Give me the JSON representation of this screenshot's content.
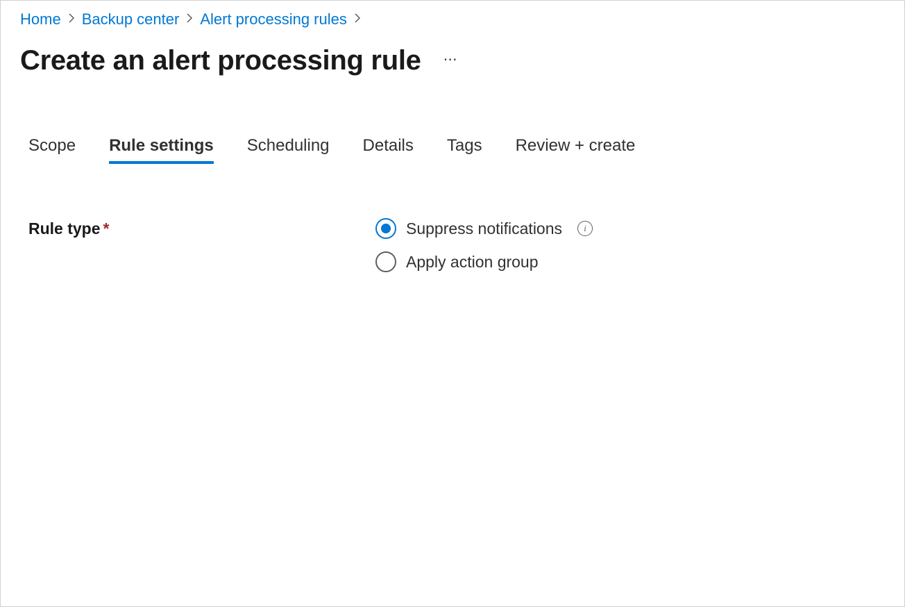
{
  "breadcrumb": {
    "items": [
      {
        "label": "Home"
      },
      {
        "label": "Backup center"
      },
      {
        "label": "Alert processing rules"
      }
    ]
  },
  "page": {
    "title": "Create an alert processing rule"
  },
  "tabs": [
    {
      "label": "Scope",
      "active": false
    },
    {
      "label": "Rule settings",
      "active": true
    },
    {
      "label": "Scheduling",
      "active": false
    },
    {
      "label": "Details",
      "active": false
    },
    {
      "label": "Tags",
      "active": false
    },
    {
      "label": "Review + create",
      "active": false
    }
  ],
  "form": {
    "ruleType": {
      "label": "Rule type",
      "required": "*",
      "options": [
        {
          "label": "Suppress notifications",
          "selected": true,
          "hasInfo": true
        },
        {
          "label": "Apply action group",
          "selected": false,
          "hasInfo": false
        }
      ]
    }
  }
}
